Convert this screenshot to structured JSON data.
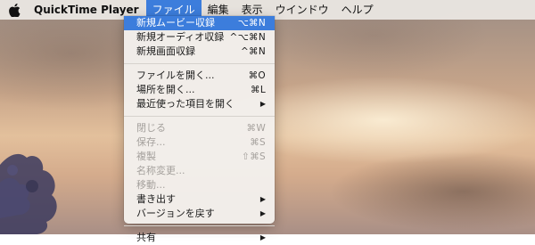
{
  "menubar": {
    "app_name": "QuickTime Player",
    "items": [
      "ファイル",
      "編集",
      "表示",
      "ウインドウ",
      "ヘルプ"
    ]
  },
  "file_menu": {
    "groups": [
      [
        {
          "label": "新規ムービー収録",
          "shortcut": "⌥⌘N",
          "state": "highlighted"
        },
        {
          "label": "新規オーディオ収録",
          "shortcut": "^⌥⌘N",
          "state": "enabled"
        },
        {
          "label": "新規画面収録",
          "shortcut": "^⌘N",
          "state": "enabled"
        }
      ],
      [
        {
          "label": "ファイルを開く...",
          "shortcut": "⌘O",
          "state": "enabled"
        },
        {
          "label": "場所を開く...",
          "shortcut": "⌘L",
          "state": "enabled"
        },
        {
          "label": "最近使った項目を開く",
          "shortcut": "▶",
          "state": "enabled",
          "submenu": true
        }
      ],
      [
        {
          "label": "閉じる",
          "shortcut": "⌘W",
          "state": "disabled"
        },
        {
          "label": "保存...",
          "shortcut": "⌘S",
          "state": "disabled"
        },
        {
          "label": "複製",
          "shortcut": "⇧⌘S",
          "state": "disabled"
        },
        {
          "label": "名称変更...",
          "shortcut": "",
          "state": "disabled"
        },
        {
          "label": "移動...",
          "shortcut": "",
          "state": "disabled"
        },
        {
          "label": "書き出す",
          "shortcut": "▶",
          "state": "enabled",
          "submenu": true
        },
        {
          "label": "バージョンを戻す",
          "shortcut": "▶",
          "state": "enabled",
          "submenu": true
        }
      ],
      [
        {
          "label": "共有",
          "shortcut": "▶",
          "state": "enabled",
          "submenu": true
        }
      ]
    ]
  },
  "colors": {
    "highlight": "#3c7ddc",
    "disabled_text": "#a5a19d"
  }
}
